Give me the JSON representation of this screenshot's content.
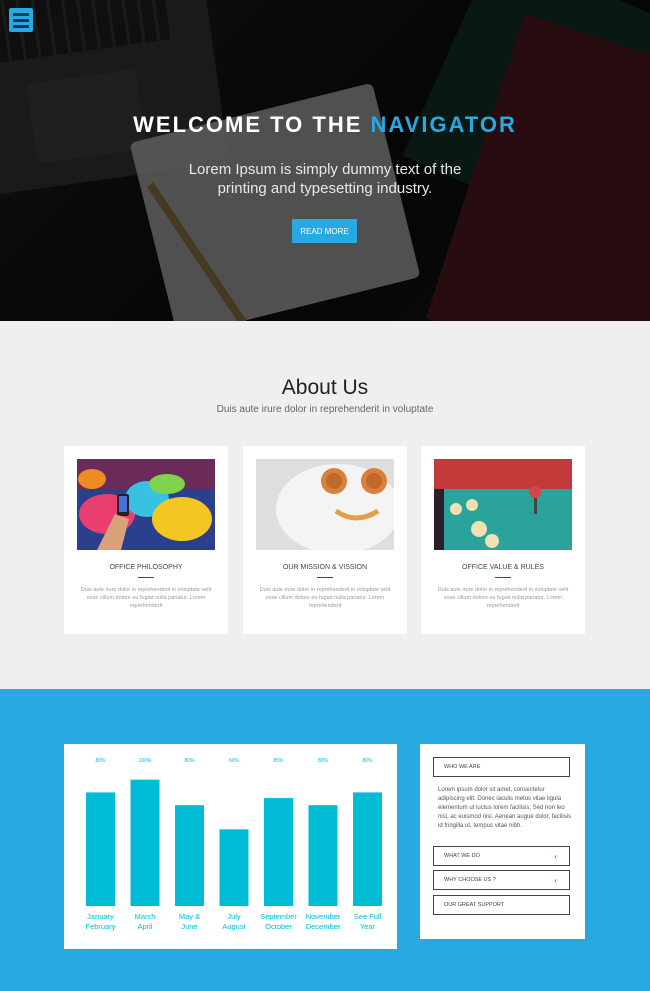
{
  "hero": {
    "title_main": "WELCOME TO THE ",
    "title_accent": "NAVIGATOR",
    "subtitle": "Lorem Ipsum is simply dummy text of the printing and typesetting industry.",
    "button": "READ MORE",
    "accent_color": "#29a9e1"
  },
  "about": {
    "title": "About Us",
    "subtitle": "Duis aute irure dolor in reprehenderit in voluptate",
    "cards": [
      {
        "title": "OFFICE PHILOSOPHY",
        "text": "Duis aute irure dolor in reprehenderit in voluptate velit esse cillum dolore eu fugiat nulla pariatur. Lorem reprehenderit"
      },
      {
        "title": "OUR MISSION & VISSION",
        "text": "Duis aute irure dolor in reprehenderit in voluptate velit esse cillum dolore eu fugiat nulla pariatur. Lorem reprehenderit"
      },
      {
        "title": "OFFICE VALUE & RULES",
        "text": "Duis aute irure dolor in reprehenderit in voluptate velit esse cillum dolore eu fugiat nulla pariatur. Lorem reprehenderit"
      }
    ]
  },
  "chart_data": {
    "type": "bar",
    "categories": [
      "January February",
      "March April",
      "May & June",
      "July August",
      "September October",
      "November December",
      "See Full Year"
    ],
    "category_lines": [
      [
        "January",
        "February"
      ],
      [
        "March",
        "April"
      ],
      [
        "May &",
        "June"
      ],
      [
        "July",
        "August"
      ],
      [
        "September",
        "October"
      ],
      [
        "November",
        "December"
      ],
      [
        "See Full",
        "Year"
      ]
    ],
    "value_labels": [
      "80%",
      "100%",
      "80%",
      "60%",
      "85%",
      "80%",
      "80%"
    ],
    "values": [
      80,
      89,
      71,
      54,
      76,
      71,
      80
    ],
    "ylim": [
      0,
      100
    ],
    "color": "#00bcd4"
  },
  "side": {
    "who": "WHO WE ARE",
    "who_text": "Lorem ipsum dolor sit amet, consectetur adipiscing elit. Donec iaculis metus vitae ligula elementum ut luctus lorem facilisis. Sed non leo nisl, ac euismod nisi. Aenean augue dolor, facilisis id fringilla ut, tempus vitae nibh.",
    "items": [
      "WHAT WE DO",
      "WHY CHOOSE US ?",
      "OUR GREAT SUPPORT"
    ]
  }
}
